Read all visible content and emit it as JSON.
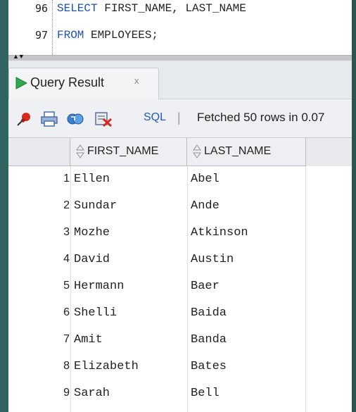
{
  "editor": {
    "lines": [
      {
        "num": "96",
        "tokens": [
          {
            "text": "SELECT ",
            "cls": "kw"
          },
          {
            "text": "FIRST_NAME, LAST_NAME",
            "cls": "id"
          }
        ]
      },
      {
        "num": "97",
        "tokens": [
          {
            "text": "FROM ",
            "cls": "kw"
          },
          {
            "text": "EMPLOYEES;",
            "cls": "id"
          }
        ]
      }
    ]
  },
  "tab": {
    "label": "Query Result",
    "close": "x"
  },
  "toolbar": {
    "sql_label": "SQL",
    "separator": "|",
    "status": "Fetched 50 rows in 0.07"
  },
  "grid": {
    "columns": [
      "FIRST_NAME",
      "LAST_NAME"
    ],
    "rows": [
      [
        "1",
        "Ellen",
        "Abel"
      ],
      [
        "2",
        "Sundar",
        "Ande"
      ],
      [
        "3",
        "Mozhe",
        "Atkinson"
      ],
      [
        "4",
        "David",
        "Austin"
      ],
      [
        "5",
        "Hermann",
        "Baer"
      ],
      [
        "6",
        "Shelli",
        "Baida"
      ],
      [
        "7",
        "Amit",
        "Banda"
      ],
      [
        "8",
        "Elizabeth",
        "Bates"
      ],
      [
        "9",
        "Sarah",
        "Bell"
      ]
    ]
  },
  "colors": {
    "keyword": "#1c52b8",
    "play_green": "#2fa84f",
    "pin_red": "#d62a1e",
    "sql_blue": "#1f5bb8"
  }
}
